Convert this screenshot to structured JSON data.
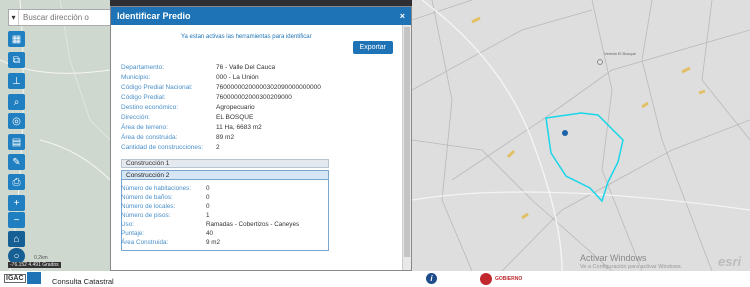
{
  "search": {
    "placeholder": "Buscar dirección o"
  },
  "panel": {
    "title": "Identificar Predio",
    "close": "×",
    "note": "Ya estan activas las herramientas para identificar",
    "export_label": "Exportar",
    "fields": [
      {
        "k": "Departamento:",
        "v": "76 - Valle Del Cauca"
      },
      {
        "k": "Municipio:",
        "v": "000 - La Unión"
      },
      {
        "k": "Código Predial Nacional:",
        "v": "76000000200000302090000000000"
      },
      {
        "k": "Código Predial:",
        "v": "760000002000300209000"
      },
      {
        "k": "Destino económico:",
        "v": "Agropecuario"
      },
      {
        "k": "Dirección:",
        "v": "EL BOSQUE"
      },
      {
        "k": "Área de terreno:",
        "v": "11 Ha, 6683 m2"
      },
      {
        "k": "Área de construida:",
        "v": "89 m2"
      },
      {
        "k": "Cantidad de construcciones:",
        "v": "2"
      }
    ],
    "construccion1": "Construcción 1",
    "construccion2": "Construcción 2",
    "sub_fields": [
      {
        "k": "Número de habitaciones:",
        "v": "0"
      },
      {
        "k": "Número de baños:",
        "v": "0"
      },
      {
        "k": "Número de locales:",
        "v": "0"
      },
      {
        "k": "Número de pisos:",
        "v": "1"
      },
      {
        "k": "Uso:",
        "v": "Ramadas - Cobertizos - Caneyes"
      },
      {
        "k": "Puntaje:",
        "v": "40"
      },
      {
        "k": "Área Construida:",
        "v": "9 m2"
      }
    ]
  },
  "map": {
    "scale_label": "0.2km",
    "coords": "-76.152 4.491 Grados",
    "activate_title": "Activar Windows",
    "activate_sub": "Ve a Configuración para activar Windows.",
    "esri": "esri",
    "label": "Vereda El Bosque"
  },
  "footer": {
    "igac": "IGAC",
    "consulta": "Consulta Catastral",
    "info": "i",
    "gobierno": "GOBIERNO"
  },
  "colors": {
    "accent": "#1d73b5",
    "parcel": "#19d6e8"
  }
}
